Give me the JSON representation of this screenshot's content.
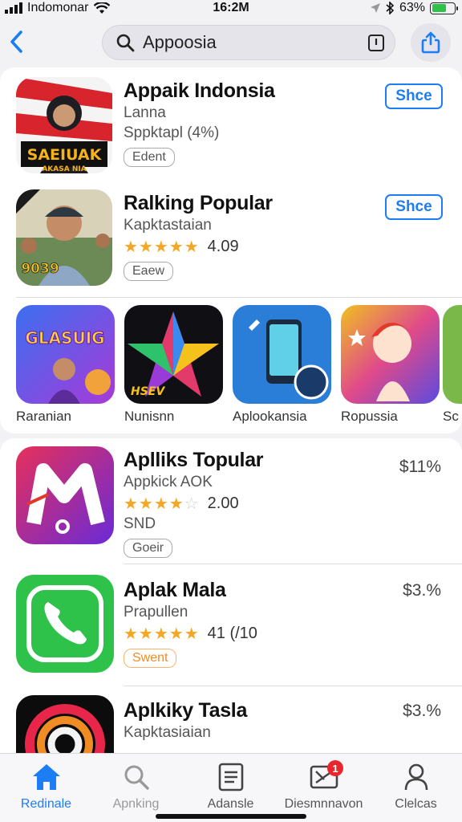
{
  "status_bar": {
    "carrier": "Indomonar",
    "time": "16:2M",
    "battery": "63%",
    "battery_level": 0.63
  },
  "search": {
    "query": "Appoosia"
  },
  "top_apps": [
    {
      "title": "Appaik Indonsia",
      "subtitle": "Lanna",
      "meta": "Sppktapl (4%)",
      "tag": "Edent",
      "button": "Shce",
      "icon_text": "SAEIUAK",
      "icon_subtext": "AKASA NIA"
    },
    {
      "title": "Ralking Popular",
      "subtitle": "Kapktastaian",
      "rating_value": "4.09",
      "rating": 5,
      "tag": "Eaew",
      "button": "Shce",
      "icon_text": "9039"
    }
  ],
  "tiles": [
    {
      "label": "Raranian",
      "icon_text": "GLASUIG"
    },
    {
      "label": "Nunisnn",
      "icon_text": "HSEV"
    },
    {
      "label": "Aplookansia"
    },
    {
      "label": "Ropussia"
    },
    {
      "label": "Sc"
    }
  ],
  "list_apps": [
    {
      "title": "Aplliks Topular",
      "subtitle": "Appkick AOK",
      "rating_value": "2.00",
      "rating": 4.5,
      "extra": "SND",
      "tag": "Goeir",
      "price": "$11%"
    },
    {
      "title": "Aplak Mala",
      "subtitle": "Prapullen",
      "rating_value": "41 (/10",
      "rating": 5,
      "tag": "Swent",
      "price": "$3.%"
    },
    {
      "title": "Aplkiky Tasla",
      "subtitle": "Kapktasiaian",
      "price": "$3.%"
    }
  ],
  "tab_bar": [
    {
      "label": "Redinale",
      "icon": "home-icon",
      "state": "active"
    },
    {
      "label": "Apnking",
      "icon": "search-icon",
      "state": "dim"
    },
    {
      "label": "Adansle",
      "icon": "document-icon",
      "state": "normal"
    },
    {
      "label": "Diesmnnavon",
      "icon": "inbox-icon",
      "state": "normal",
      "badge": "1"
    },
    {
      "label": "Clelcas",
      "icon": "person-icon",
      "state": "normal"
    }
  ],
  "colors": {
    "accent": "#1c7df5",
    "star": "#f5a623",
    "badge": "#e8262e"
  }
}
